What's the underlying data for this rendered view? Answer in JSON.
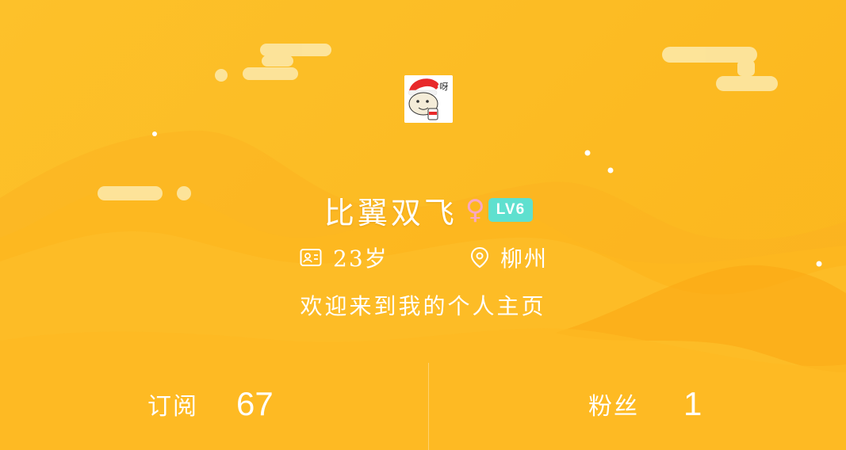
{
  "profile": {
    "name": "比翼双飞",
    "gender_symbol": "♀",
    "level": "LV6",
    "age": "23岁",
    "location": "柳州",
    "bio": "欢迎来到我的个人主页",
    "avatar_caption": "呀"
  },
  "stats": {
    "subscribe_label": "订阅",
    "subscribe_value": "67",
    "fans_label": "粉丝",
    "fans_value": "1"
  },
  "icons": {
    "age": "id-card-icon",
    "location": "location-pin-icon",
    "gender": "female-icon"
  },
  "colors": {
    "background": "#fcbc24",
    "level_badge": "#5fe0cf",
    "gender": "#f9a7c3",
    "text": "#ffffff"
  }
}
